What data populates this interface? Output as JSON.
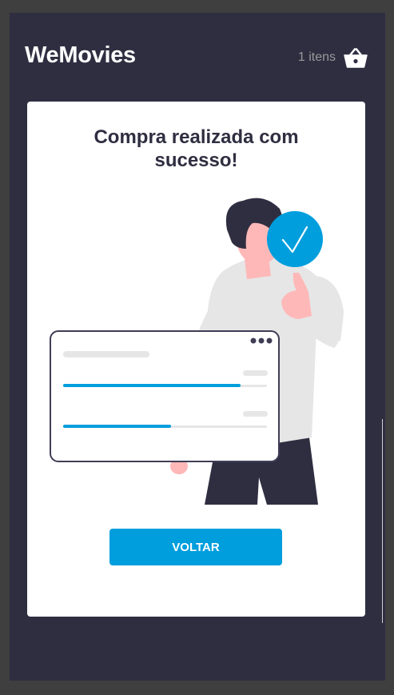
{
  "header": {
    "logo": "WeMovies",
    "cart_count_label": "1 itens",
    "cart_icon": "basket-icon"
  },
  "main": {
    "title_line1": "Compra realizada com",
    "title_line2": "sucesso!",
    "illustration": "purchase-success-illustration",
    "back_button_label": "VOLTAR"
  },
  "illustration_data": {
    "progress_1": 0.87,
    "progress_2": 0.53,
    "menu_dots": 3
  },
  "colors": {
    "background": "#2f2e41",
    "card": "#ffffff",
    "accent": "#009edd",
    "text": "#2f2e41",
    "muted": "#999999"
  }
}
